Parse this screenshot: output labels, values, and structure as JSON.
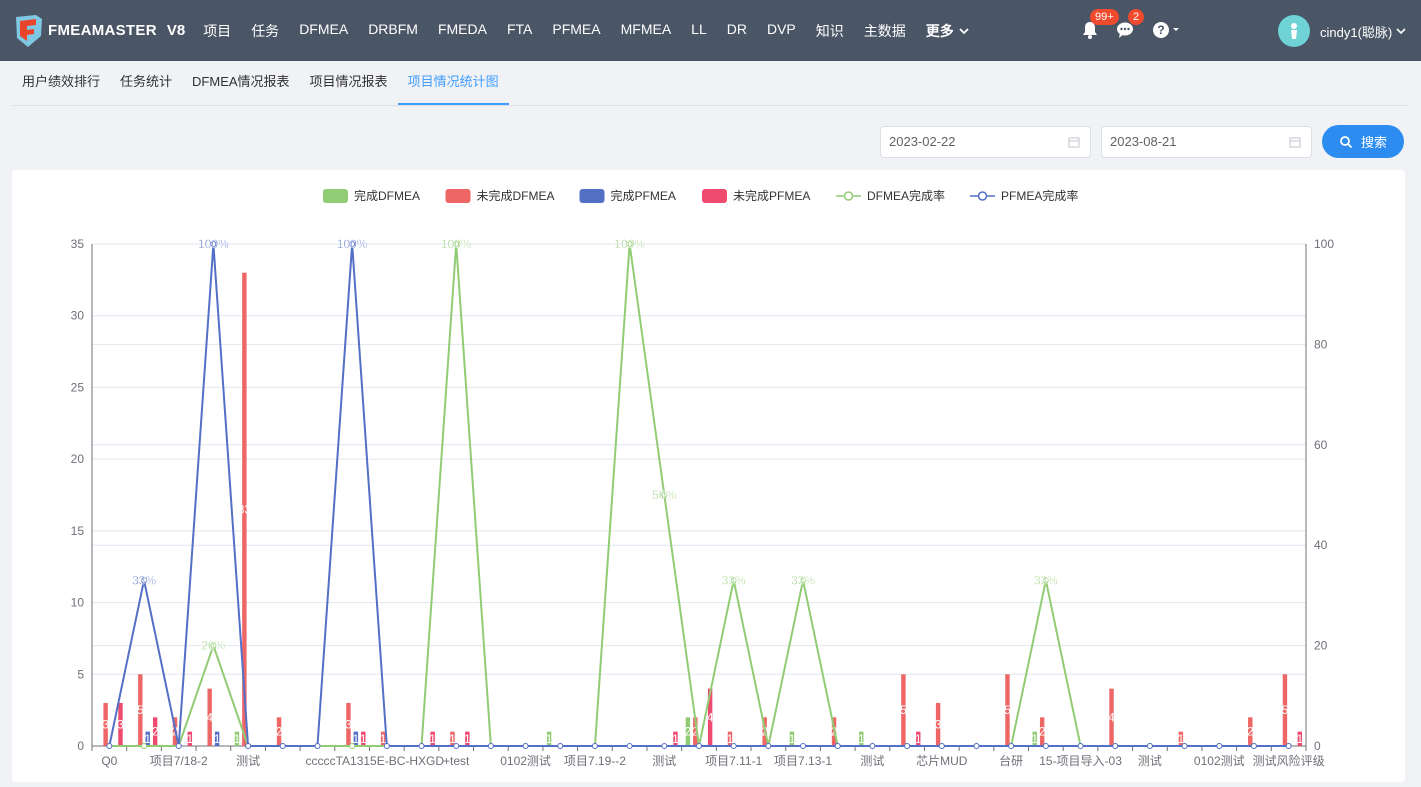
{
  "app": {
    "logo_text": "FMEAMASTER",
    "version": "V8"
  },
  "nav": {
    "items": [
      "项目",
      "任务",
      "DFMEA",
      "DRBFM",
      "FMEDA",
      "FTA",
      "PFMEA",
      "MFMEA",
      "LL",
      "DR",
      "DVP",
      "知识",
      "主数据"
    ],
    "more_label": "更多"
  },
  "header": {
    "notif_badge": "99+",
    "msg_badge": "2",
    "user_name": "cindy1(聪脉)"
  },
  "tabs": [
    "用户绩效排行",
    "任务统计",
    "DFMEA情况报表",
    "项目情况报表",
    "项目情况统计图"
  ],
  "active_tab_index": 4,
  "filters": {
    "start_date": "2023-02-22",
    "end_date": "2023-08-21",
    "search_label": "搜索"
  },
  "colors": {
    "done_dfmea": "#91cc75",
    "undone_dfmea": "#ee6666",
    "done_pfmea": "#5470c6",
    "undone_pfmea": "#ef4a6f",
    "accent": "#2d8cf0"
  },
  "chart_data": {
    "type": "bar",
    "legend": [
      "完成DFMEA",
      "未完成DFMEA",
      "完成PFMEA",
      "未完成PFMEA",
      "DFMEA完成率",
      "PFMEA完成率"
    ],
    "legend_position": "top-center",
    "y_left": {
      "min": 0,
      "max": 35,
      "ticks": [
        0,
        5,
        10,
        15,
        20,
        25,
        30,
        35
      ]
    },
    "y_right": {
      "min": 0,
      "max": 100,
      "ticks": [
        0,
        20,
        40,
        60,
        80,
        100
      ]
    },
    "category_count": 35,
    "x_tick_labels": [
      "Q0",
      "项目7/18-2",
      "测试",
      "cccc",
      "cTA1315E-BC-HXGD",
      "+test",
      "0102测试",
      "项目7.19--2",
      "测试",
      "项目7.11-1",
      "项目7.13-1",
      "测试",
      "芯片MUD",
      "台研",
      "15-项目导入-03",
      "测试",
      "0102测试",
      "测试风险评级"
    ],
    "x_tick_label_indices": [
      0,
      2,
      4,
      6,
      8,
      10,
      12,
      14,
      16,
      18,
      20,
      22,
      24,
      26,
      28,
      30,
      32,
      34
    ],
    "series": [
      {
        "name": "完成DFMEA",
        "values": [
          0,
          0,
          0,
          0,
          1,
          0,
          0,
          0,
          0,
          0,
          0,
          0,
          0,
          1,
          0,
          0,
          0,
          2,
          0,
          0,
          1,
          0,
          1,
          0,
          0,
          0,
          0,
          1,
          0,
          0,
          0,
          0,
          0,
          0,
          0
        ]
      },
      {
        "name": "未完成DFMEA",
        "values": [
          3,
          5,
          2,
          4,
          33,
          2,
          0,
          3,
          1,
          0,
          1,
          0,
          0,
          0,
          0,
          0,
          0,
          2,
          1,
          2,
          0,
          2,
          0,
          5,
          3,
          0,
          5,
          2,
          0,
          4,
          0,
          1,
          0,
          2,
          5
        ]
      },
      {
        "name": "完成PFMEA",
        "values": [
          0,
          1,
          0,
          1,
          0,
          0,
          0,
          1,
          0,
          0,
          0,
          0,
          0,
          0,
          0,
          0,
          0,
          0,
          0,
          0,
          0,
          0,
          0,
          0,
          0,
          0,
          0,
          0,
          0,
          0,
          0,
          0,
          0,
          0,
          0
        ]
      },
      {
        "name": "未完成PFMEA",
        "values": [
          3,
          2,
          1,
          0,
          0,
          0,
          0,
          1,
          0,
          1,
          1,
          0,
          0,
          0,
          0,
          0,
          1,
          4,
          0,
          0,
          0,
          0,
          0,
          1,
          0,
          0,
          0,
          0,
          0,
          0,
          0,
          0,
          0,
          0,
          1
        ]
      },
      {
        "name": "DFMEA完成率",
        "type": "line",
        "values": [
          0,
          0,
          0,
          20,
          0,
          0,
          0,
          0,
          0,
          0,
          100,
          0,
          0,
          0,
          0,
          100,
          50,
          0,
          33,
          0,
          33,
          0,
          0,
          0,
          0,
          0,
          0,
          33,
          0,
          0,
          0,
          0,
          0,
          0,
          0
        ]
      },
      {
        "name": "PFMEA完成率",
        "type": "line",
        "values": [
          0,
          33,
          0,
          100,
          0,
          0,
          0,
          100,
          0,
          0,
          0,
          0,
          0,
          0,
          0,
          0,
          0,
          0,
          0,
          0,
          0,
          0,
          0,
          0,
          0,
          0,
          0,
          0,
          0,
          0,
          0,
          0,
          0,
          0,
          0
        ]
      }
    ],
    "rate_labels": [
      {
        "series": "DFMEA完成率",
        "index": 3,
        "text": "20%"
      },
      {
        "series": "DFMEA完成率",
        "index": 10,
        "text": "100%"
      },
      {
        "series": "DFMEA完成率",
        "index": 15,
        "text": "100%"
      },
      {
        "series": "DFMEA完成率",
        "index": 16,
        "text": "50%"
      },
      {
        "series": "DFMEA完成率",
        "index": 18,
        "text": "33%"
      },
      {
        "series": "DFMEA完成率",
        "index": 20,
        "text": "33%"
      },
      {
        "series": "DFMEA完成率",
        "index": 27,
        "text": "33%"
      },
      {
        "series": "PFMEA完成率",
        "index": 1,
        "text": "33%"
      },
      {
        "series": "PFMEA完成率",
        "index": 3,
        "text": "100%"
      },
      {
        "series": "PFMEA完成率",
        "index": 7,
        "text": "100%"
      }
    ]
  }
}
